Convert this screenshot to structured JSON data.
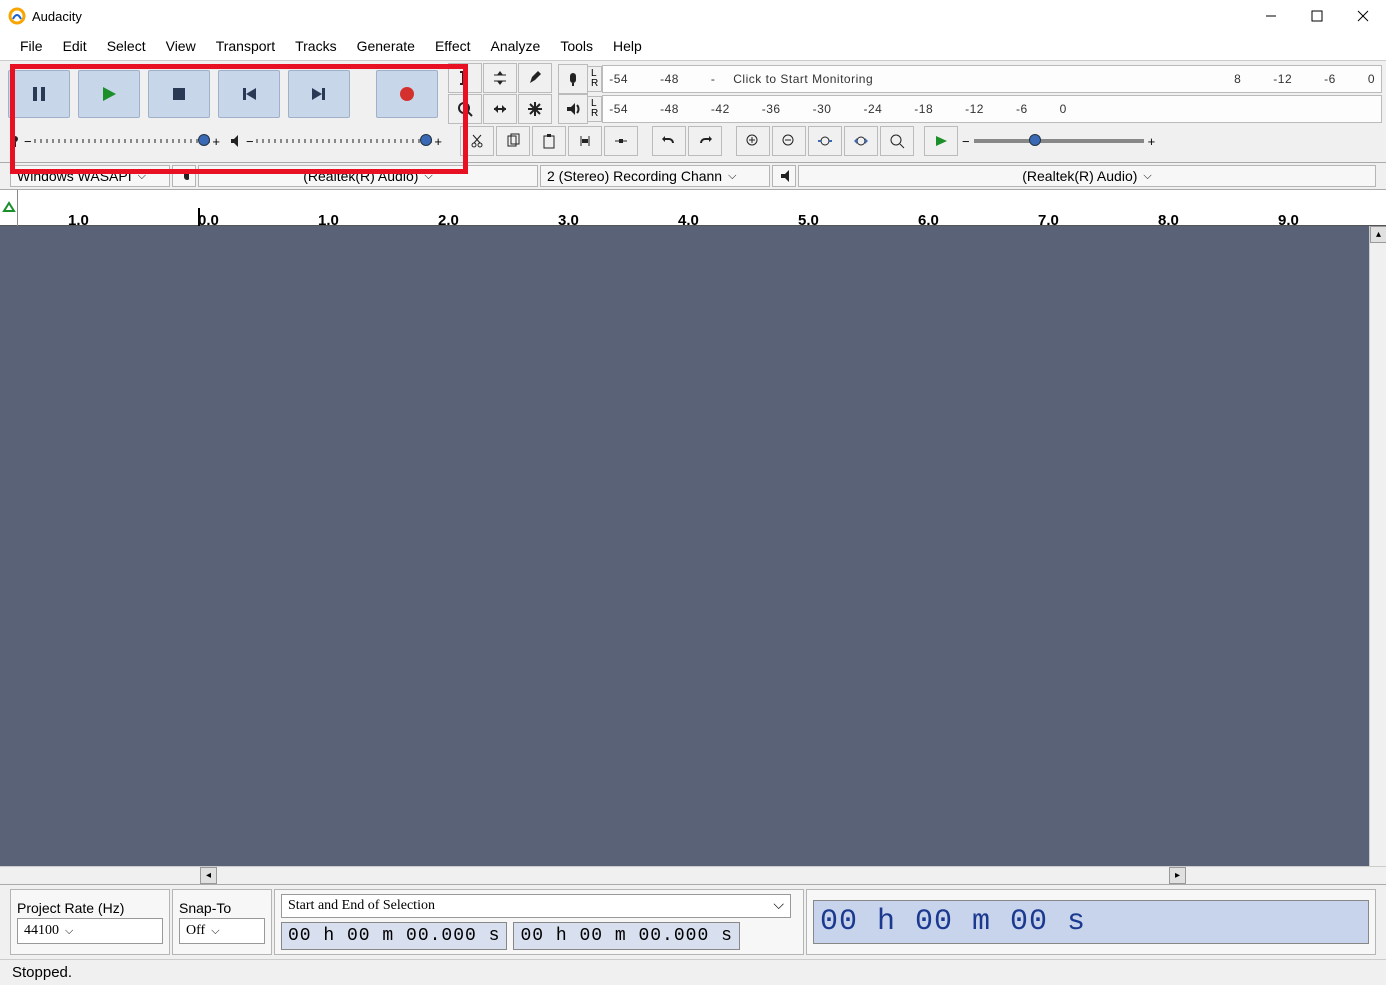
{
  "app_title": "Audacity",
  "menu": [
    "File",
    "Edit",
    "Select",
    "View",
    "Transport",
    "Tracks",
    "Generate",
    "Effect",
    "Analyze",
    "Tools",
    "Help"
  ],
  "transport_icons": [
    "pause",
    "play",
    "stop",
    "skip-start",
    "skip-end",
    "record"
  ],
  "meter": {
    "rec_ticks": [
      "-54",
      "-48",
      "-"
    ],
    "monitoring_text": "Click to Start Monitoring",
    "rec_ticks_right": [
      "8",
      "-12",
      "-6",
      "0"
    ],
    "play_ticks": [
      "-54",
      "-48",
      "-42",
      "-36",
      "-30",
      "-24",
      "-18",
      "-12",
      "-6",
      "0"
    ]
  },
  "device": {
    "host": "Windows WASAPI",
    "rec_device": "(Realtek(R) Audio)",
    "rec_channels": "2 (Stereo) Recording Chann",
    "play_device": "(Realtek(R) Audio)"
  },
  "ruler_ticks": [
    "1.0",
    "0.0",
    "1.0",
    "2.0",
    "3.0",
    "4.0",
    "5.0",
    "6.0",
    "7.0",
    "8.0",
    "9.0"
  ],
  "bottom": {
    "project_rate_label": "Project Rate (Hz)",
    "project_rate": "44100",
    "snap_to_label": "Snap-To",
    "snap_to": "Off",
    "selection_label": "Start and End of Selection",
    "selection_start": "00 h 00 m 00.000 s",
    "selection_end": "00 h 00 m 00.000 s",
    "position": "00 h 00 m 00 s"
  },
  "status": "Stopped.",
  "sliders": {
    "minus": "−",
    "plus": "+"
  }
}
